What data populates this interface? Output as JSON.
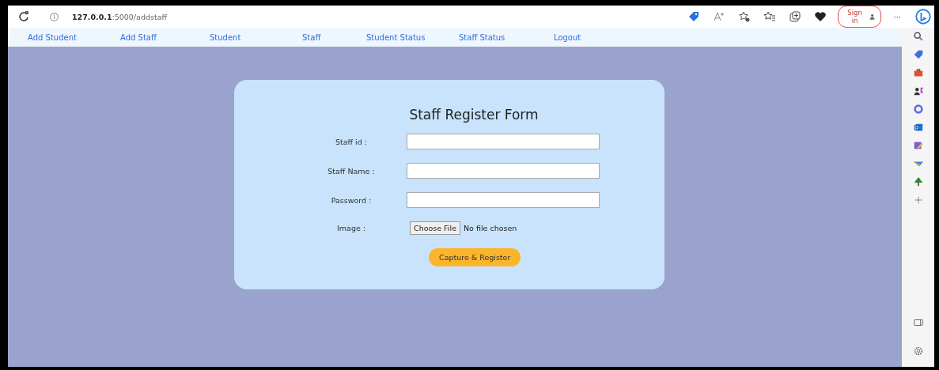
{
  "browser": {
    "url": "**127.0.0.1**:5000/addstaff",
    "sign_in": "Sign in",
    "more": "···"
  },
  "nav": [
    {
      "label": "Add Student"
    },
    {
      "label": "Add Staff"
    },
    {
      "label": "Student"
    },
    {
      "label": "Staff"
    },
    {
      "label": "Student Status"
    },
    {
      "label": "Staff Status"
    },
    {
      "label": "Logout"
    }
  ],
  "form": {
    "title": "Staff Register Form",
    "fields": [
      {
        "label": "Staff id :",
        "kind": "text"
      },
      {
        "label": "Staff Name :",
        "kind": "text"
      },
      {
        "label": "Password :",
        "kind": "password"
      },
      {
        "label": "Image :",
        "kind": "file",
        "button": "Choose File",
        "status": "No file chosen"
      }
    ],
    "submit": "Capture & Register"
  }
}
